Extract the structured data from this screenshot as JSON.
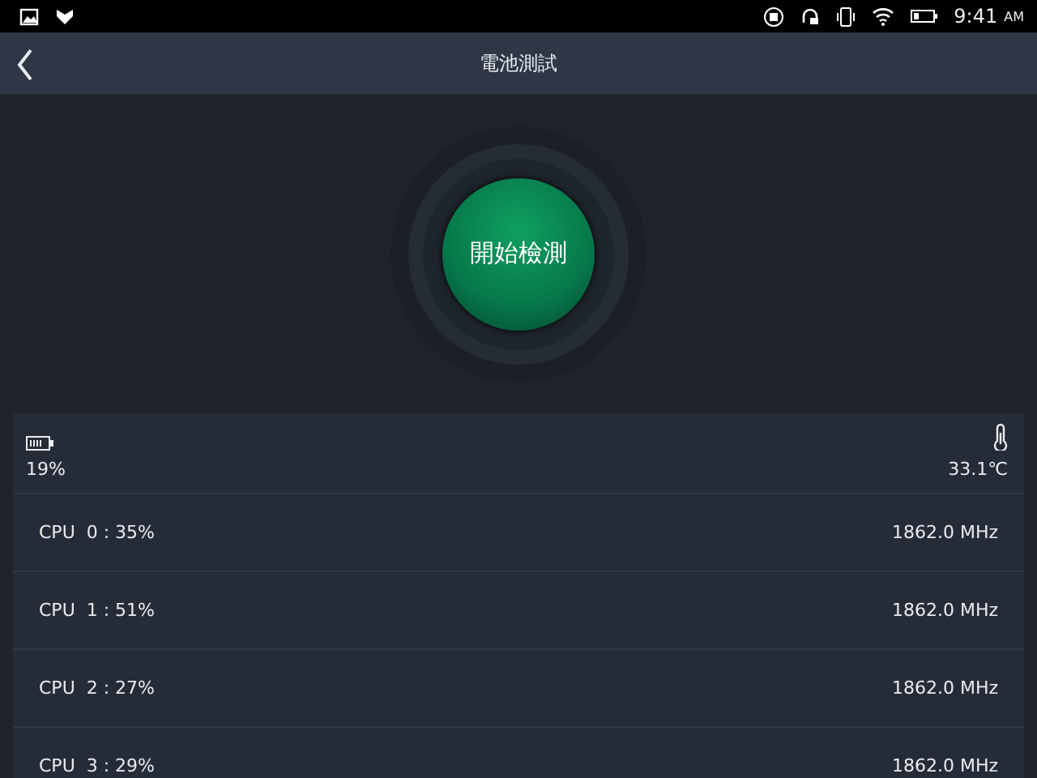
{
  "status_bar": {
    "time": "9:41",
    "ampm": "AM"
  },
  "header": {
    "title": "電池測試"
  },
  "start_button": {
    "label": "開始檢測"
  },
  "info": {
    "battery": "19%",
    "temperature": "33.1℃"
  },
  "cpu_rows": [
    {
      "label": "CPU  0 : 35%",
      "frequency": "1862.0 MHz"
    },
    {
      "label": "CPU  1 : 51%",
      "frequency": "1862.0 MHz"
    },
    {
      "label": "CPU  2 : 27%",
      "frequency": "1862.0 MHz"
    },
    {
      "label": "CPU  3 : 29%",
      "frequency": "1862.0 MHz"
    }
  ]
}
